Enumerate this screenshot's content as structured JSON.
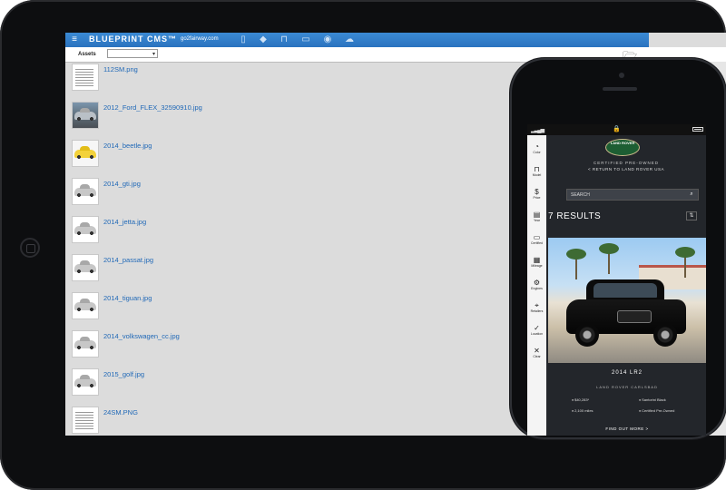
{
  "tablet": {
    "header": {
      "title": "BLUEPRINT CMS™",
      "url": "go2fairway.com",
      "icons": [
        "menu-icon",
        "document-icon",
        "tag-icon",
        "car-icon",
        "folder-icon",
        "eye-icon",
        "cloud-upload-icon"
      ]
    },
    "subbar": {
      "label": "Assets",
      "select_value": "▾"
    },
    "files": [
      {
        "name": "112SM.png",
        "thumb": "doc"
      },
      {
        "name": "2012_Ford_FLEX_32590910.jpg",
        "thumb": "photo"
      },
      {
        "name": "2014_beetle.jpg",
        "thumb": "yellow"
      },
      {
        "name": "2014_gti.jpg",
        "thumb": "car"
      },
      {
        "name": "2014_jetta.jpg",
        "thumb": "car"
      },
      {
        "name": "2014_passat.jpg",
        "thumb": "car"
      },
      {
        "name": "2014_tiguan.jpg",
        "thumb": "car"
      },
      {
        "name": "2014_volkswagen_cc.jpg",
        "thumb": "car"
      },
      {
        "name": "2015_golf.jpg",
        "thumb": "car"
      },
      {
        "name": "24SM.PNG",
        "thumb": "doc"
      }
    ]
  },
  "phone": {
    "sidebar": [
      {
        "label": "Color",
        "icon": "palette-icon",
        "glyph": "◔"
      },
      {
        "label": "Model",
        "icon": "car-icon",
        "glyph": "⊓"
      },
      {
        "label": "Price",
        "icon": "dollar-icon",
        "glyph": "$"
      },
      {
        "label": "Year",
        "icon": "calendar-icon",
        "glyph": "▤"
      },
      {
        "label": "Certified",
        "icon": "certified-icon",
        "glyph": "▭"
      },
      {
        "label": "Mileage",
        "icon": "odometer-icon",
        "glyph": "▦"
      },
      {
        "label": "Engines",
        "icon": "engine-icon",
        "glyph": "⚙"
      },
      {
        "label": "Retailers",
        "icon": "location-pin-icon",
        "glyph": "⌖"
      },
      {
        "label": "Location",
        "icon": "check-icon",
        "glyph": "✓"
      },
      {
        "label": "Clear",
        "icon": "close-icon",
        "glyph": "✕"
      }
    ],
    "logo": "LAND ROVER",
    "subtitle": "CERTIFIED PRE-OWNED",
    "back_link": "< RETURN TO LAND ROVER USA",
    "search_placeholder": "SEARCH",
    "results": "7 RESULTS",
    "card": {
      "model": "2014 LR2",
      "dealer": "LAND ROVER CARLSBAD",
      "price": "$40,283*",
      "color": "Santorini Black",
      "miles": "2,100 miles",
      "certified": "Certified Pre-Owned",
      "cta": "FIND OUT MORE >"
    }
  }
}
